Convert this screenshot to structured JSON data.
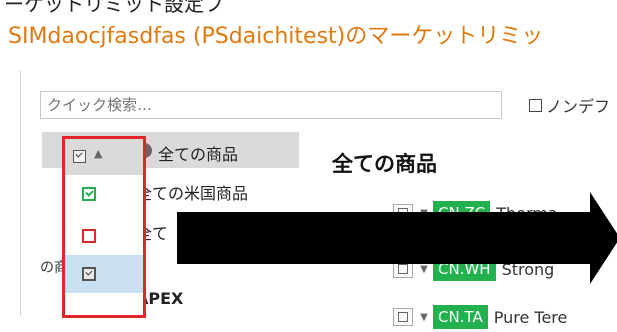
{
  "header": {
    "cropped_title": "ーケットリミット設定フ",
    "dialog_title": "SIMdaocjfasdfas (PSdaichitest)のマーケットリミッ"
  },
  "search": {
    "placeholder": "クイック検索…",
    "value": ""
  },
  "nondefault": {
    "label": "ノンデフ",
    "checked": false
  },
  "tree": {
    "selected_label": "全ての商品",
    "items": [
      "全ての米国商品",
      "全て",
      "の商",
      "APEX"
    ]
  },
  "main": {
    "section_title": "全ての商品",
    "products": [
      {
        "code": "CN.ZC",
        "name": "Therma"
      },
      {
        "code": "CN.WH",
        "name": "Strong"
      },
      {
        "code": "CN.TA",
        "name": "Pure Tere"
      }
    ]
  },
  "dropdown": {
    "header_caret": "▲",
    "options": [
      {
        "icon": "checked-box-icon",
        "color": "#22b14c"
      },
      {
        "icon": "unchecked-box-icon",
        "color": "#e0262a"
      },
      {
        "icon": "default-box-icon",
        "color": "#555555"
      }
    ],
    "highlight_color": "#e0262a"
  },
  "colors": {
    "accent": "#e07a10",
    "code_badge": "#22b14c"
  }
}
